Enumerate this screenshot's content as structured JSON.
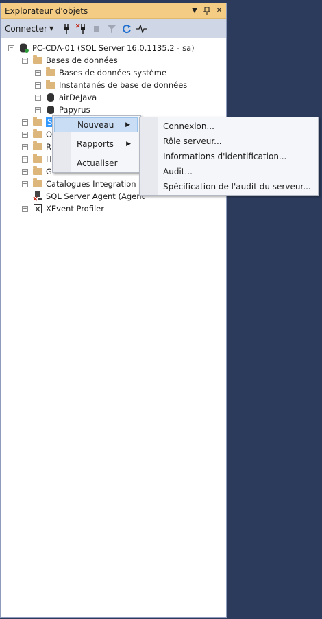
{
  "panel": {
    "title": "Explorateur d'objets",
    "title_buttons": {
      "dropdown": "▼",
      "pin": "⊥",
      "close": "✕"
    }
  },
  "toolbar": {
    "connect_label": "Connecter",
    "icons": [
      "connect-plug-icon",
      "disconnect-icon",
      "stop-icon",
      "filter-icon",
      "refresh-icon",
      "activity-monitor-icon"
    ]
  },
  "tree": {
    "server": "PC-CDA-01 (SQL Server 16.0.1135.2 - sa)",
    "databases": "Bases de données",
    "system_databases": "Bases de données système",
    "snapshots": "Instantanés de base de données",
    "db1": "airDeJava",
    "db2": "Papyrus",
    "security_partial": "S",
    "o_partial": "O",
    "r_partial": "R",
    "h_partial": "H",
    "g_partial": "G",
    "catalogs": "Catalogues Integration Se",
    "agent": "SQL Server Agent (Agent ",
    "xevent": "XEvent Profiler"
  },
  "context_menu": {
    "new": "Nouveau",
    "reports": "Rapports",
    "refresh": "Actualiser"
  },
  "submenu": {
    "items": [
      "Connexion...",
      "Rôle serveur...",
      "Informations d'identification...",
      "Audit...",
      "Spécification de l'audit du serveur..."
    ]
  }
}
